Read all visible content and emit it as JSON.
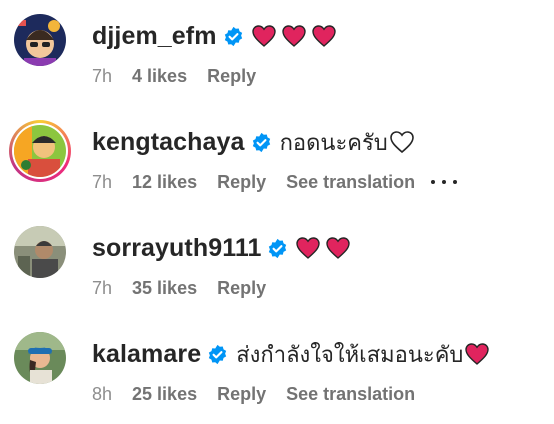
{
  "comments": [
    {
      "username": "djjem_efm",
      "text": "",
      "hearts": 3,
      "time": "7h",
      "likes": "4 likes",
      "reply": "Reply",
      "translation": "",
      "avatar_icon": "avatar-icon"
    },
    {
      "username": "kengtachaya",
      "text": "กอดนะครับ",
      "hearts": 1,
      "heart_style": "outline",
      "time": "7h",
      "likes": "12 likes",
      "reply": "Reply",
      "translation": "See translation",
      "avatar_icon": "avatar-icon"
    },
    {
      "username": "sorrayuth9111",
      "text": "",
      "hearts": 2,
      "time": "7h",
      "likes": "35 likes",
      "reply": "Reply",
      "translation": "",
      "avatar_icon": "avatar-icon"
    },
    {
      "username": "kalamare",
      "text": "ส่งกำลังใจให้เสมอนะคับ",
      "hearts": 1,
      "time": "8h",
      "likes": "25 likes",
      "reply": "Reply",
      "translation": "See translation",
      "avatar_icon": "avatar-icon"
    }
  ],
  "colors": {
    "verified_blue": "#0095f6",
    "heart_red": "#e0245e",
    "secondary_text": "#737373"
  }
}
